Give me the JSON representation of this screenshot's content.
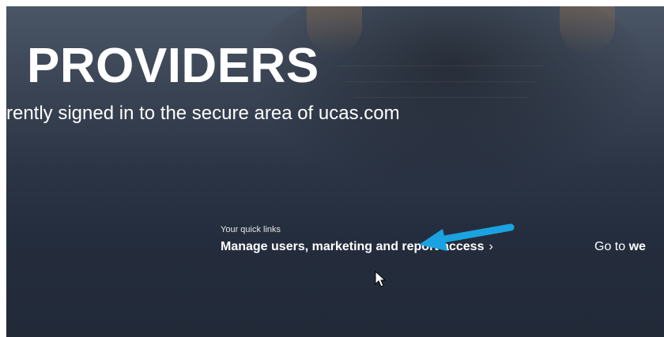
{
  "hero": {
    "title": "PROVIDERS",
    "subtitle": "rrently signed in to the secure area of ucas.com"
  },
  "quick_links": {
    "label": "Your quick links",
    "manage_link": "Manage users, marketing and report access",
    "manage_chevron": "›",
    "goto_prefix": "Go to ",
    "goto_bold": "we"
  },
  "colors": {
    "annotation_arrow": "#1aa3e0",
    "hero_bg": "#2b3445",
    "text": "#ffffff"
  },
  "icons": {
    "annotation": "arrow-left-icon",
    "pointer": "mouse-cursor-icon"
  }
}
